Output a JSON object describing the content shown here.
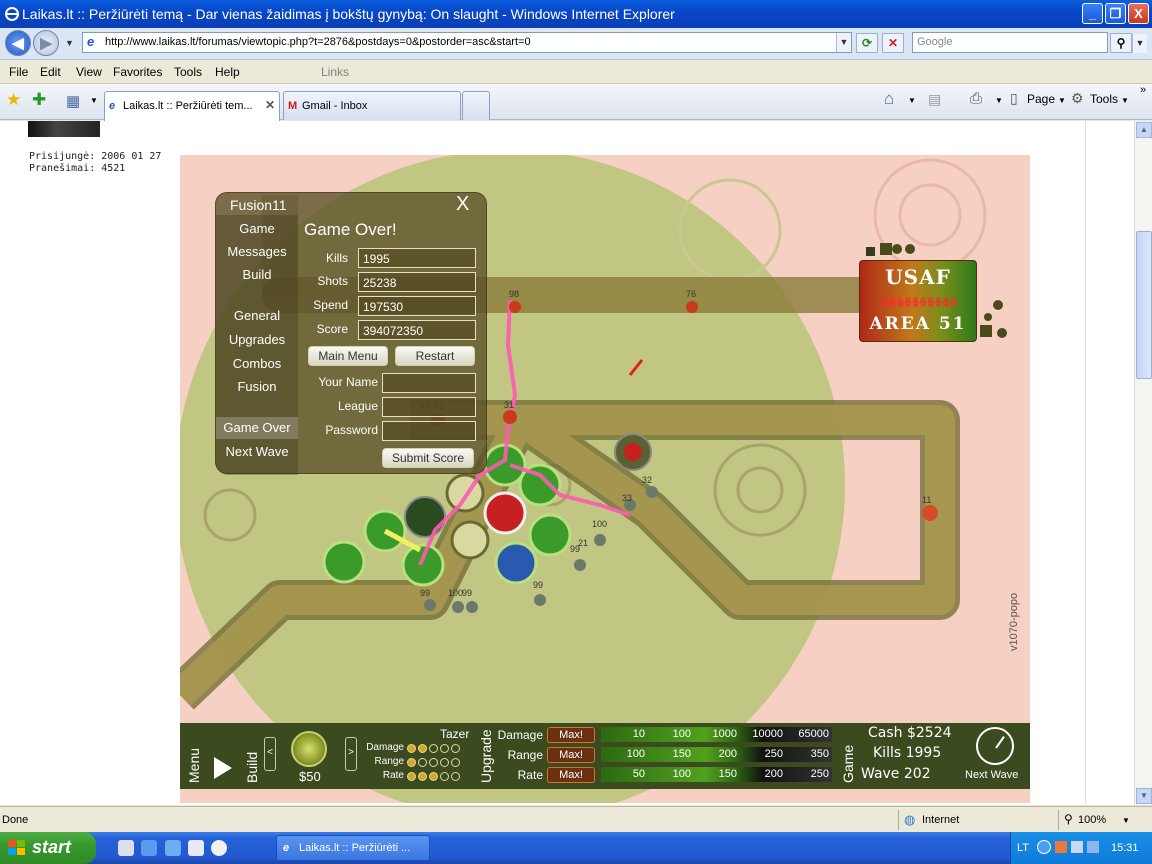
{
  "window": {
    "title": "Laikas.lt :: Peržiūrėti temą - Dar vienas žaidimas į bokštų gynybą: On slaught - Windows Internet Explorer",
    "minimize": "_",
    "restore": "❐",
    "close": "X"
  },
  "address": {
    "url": "http://www.laikas.lt/forumas/viewtopic.php?t=2876&postdays=0&postorder=asc&start=0",
    "search_placeholder": "Google"
  },
  "menu": {
    "items": [
      "File",
      "Edit",
      "View",
      "Favorites",
      "Tools",
      "Help"
    ],
    "links": "Links"
  },
  "tabs": {
    "items": [
      {
        "label": "Laikas.lt :: Peržiūrėti tem...",
        "icon": "ie-icon"
      },
      {
        "label": "Gmail - Inbox",
        "icon": "gmail-icon"
      }
    ],
    "page_label": "Page",
    "tools_label": "Tools"
  },
  "profile": {
    "joined": "Prisijungė: 2006 01 27",
    "posts": "Pranešimai: 4521"
  },
  "game": {
    "base": {
      "line1": "USAF",
      "line2": "AREA 51",
      "lives_glyphs": "ꆜꆜꆜꆜꆜꆜꆜꆜꆜꆜ"
    },
    "panel": {
      "title": "Fusion11",
      "close": "X",
      "side_items": [
        "Game",
        "Messages",
        "Build",
        "General",
        "Upgrades",
        "Combos",
        "Fusion",
        "Game Over",
        "Next Wave"
      ],
      "selected": "Game Over",
      "heading": "Game Over!",
      "fields": [
        {
          "label": "Kills",
          "value": "1995"
        },
        {
          "label": "Shots",
          "value": "25238"
        },
        {
          "label": "Spend",
          "value": "197530"
        },
        {
          "label": "Score",
          "value": "394072350"
        }
      ],
      "main_menu": "Main Menu",
      "restart": "Restart",
      "form": [
        {
          "label": "Your Name",
          "value": ""
        },
        {
          "label": "League",
          "value": ""
        },
        {
          "label": "Password",
          "value": ""
        }
      ],
      "submit": "Submit Score"
    },
    "map_numbers": [
      "98",
      "76",
      "44",
      "31",
      "31",
      "32",
      "33",
      "100",
      "11",
      "21",
      "99",
      "99",
      "100",
      "99",
      "99"
    ],
    "toolbar": {
      "menu": "Menu",
      "build": "Build",
      "tower_name": "Tazer",
      "price": "$50",
      "prev": "<",
      "next": ">",
      "tower_stats": [
        {
          "label": "Damage",
          "level": 2
        },
        {
          "label": "Range",
          "level": 1
        },
        {
          "label": "Rate",
          "level": 3
        }
      ],
      "upgrade": "Upgrade",
      "upgrades": [
        {
          "label": "Damage",
          "max": "Max!",
          "ticks": [
            "10",
            "100",
            "1000",
            "10000",
            "65000"
          ]
        },
        {
          "label": "Range",
          "max": "Max!",
          "ticks": [
            "100",
            "150",
            "200",
            "250",
            "350"
          ]
        },
        {
          "label": "Rate",
          "max": "Max!",
          "ticks": [
            "50",
            "100",
            "150",
            "200",
            "250"
          ]
        }
      ],
      "game": "Game",
      "cash": "Cash $2524",
      "kills": "Kills 1995",
      "wave": "Wave 202",
      "next_wave": "Next Wave"
    },
    "version": "v1070-popo"
  },
  "status": {
    "text": "Done",
    "zone": "Internet",
    "zoom": "100%"
  },
  "taskbar": {
    "start": "start",
    "task": "Laikas.lt :: Peržiūrėti ...",
    "lang": "LT",
    "clock": "15:31"
  }
}
